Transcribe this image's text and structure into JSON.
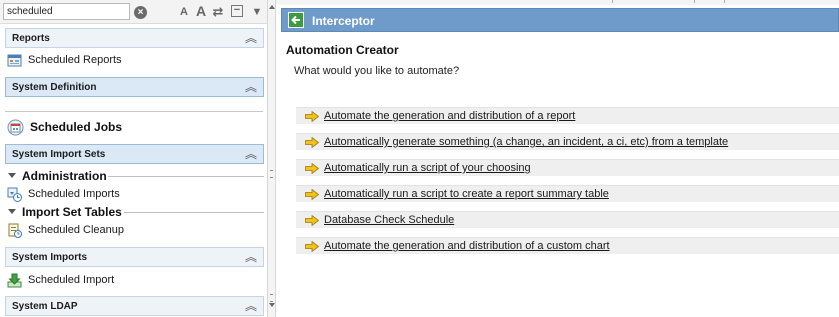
{
  "filter": {
    "value": "scheduled",
    "placeholder": ""
  },
  "toolbar": {
    "clear_icon": "clear-icon",
    "smaller_text_label": "A",
    "larger_text_label": "A",
    "refresh_icon": "refresh-icon",
    "collapse_all_icon": "collapse-all-icon",
    "menu_icon": "chevron-down-icon"
  },
  "navigator": {
    "reports": {
      "label": "Reports",
      "modules": [
        {
          "label": "Scheduled Reports",
          "icon": "report-icon"
        }
      ]
    },
    "system_definition": {
      "label": "System Definition",
      "modules": [
        {
          "label": "Scheduled Jobs",
          "icon": "calendar-icon"
        }
      ]
    },
    "system_import_sets": {
      "label": "System Import Sets",
      "sections": [
        {
          "label": "Administration",
          "modules": [
            {
              "label": "Scheduled Imports",
              "icon": "import-schedule-icon"
            }
          ]
        },
        {
          "label": "Import Set Tables",
          "modules": [
            {
              "label": "Scheduled Cleanup",
              "icon": "cleanup-icon"
            }
          ]
        }
      ]
    },
    "system_imports": {
      "label": "System Imports",
      "modules": [
        {
          "label": "Scheduled Import",
          "icon": "download-icon"
        }
      ]
    },
    "system_ldap": {
      "label": "System LDAP"
    }
  },
  "content": {
    "window_title": "Interceptor",
    "heading": "Automation Creator",
    "question": "What would you like to automate?",
    "options": [
      "Automate the generation and distribution of a report",
      "Automatically generate something (a change, an incident, a ci, etc) from a template",
      "Automatically run a script of your choosing",
      "Automatically run a script to create a report summary table",
      "Database Check Schedule",
      "Automate the generation and distribution of a custom chart"
    ]
  },
  "colors": {
    "title_bar": "#6f9bcb",
    "active_header": "#dbe8f6",
    "arrow_icon": "#f2c21b",
    "back_button": "#3c9b3c"
  }
}
